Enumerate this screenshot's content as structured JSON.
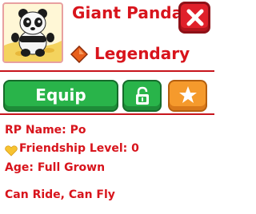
{
  "pet": {
    "name": "Giant Panda",
    "rarity": "Legendary",
    "image_icon": "panda-icon"
  },
  "actions": {
    "equip_label": "Equip",
    "lock_icon": "unlock-icon",
    "favorite_icon": "star-icon",
    "close_icon": "close-icon"
  },
  "details": {
    "rp_name": "RP Name: Po",
    "friendship": "Friendship Level: 0",
    "age": "Age: Full Grown",
    "abilities": "Can Ride, Can Fly"
  },
  "colors": {
    "accent_red": "#d8141c",
    "equip_green": "#29b44a",
    "favorite_orange": "#f59a2c",
    "close_red": "#e0202a",
    "rarity_gem": "#e8601c",
    "heart": "#f7c331"
  }
}
